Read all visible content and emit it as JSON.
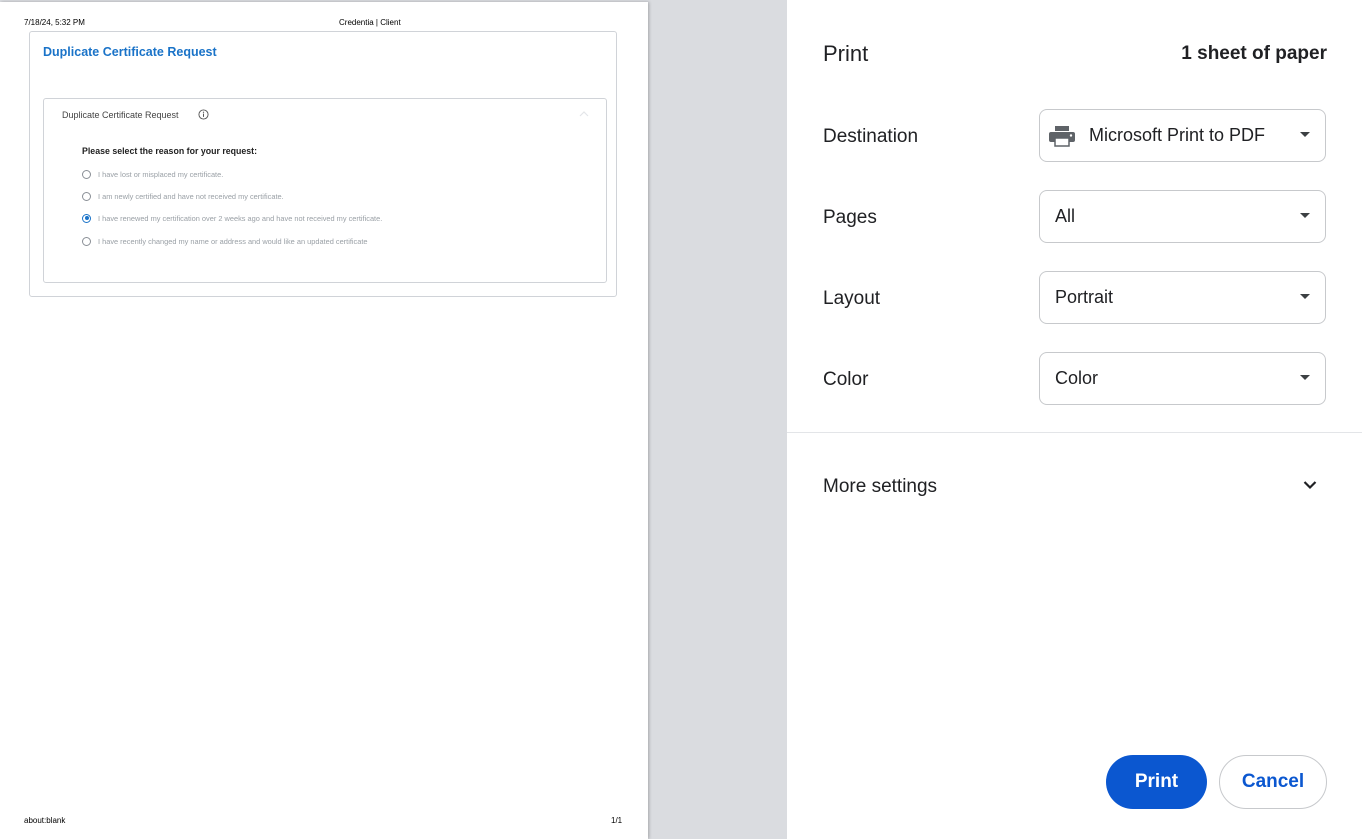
{
  "preview": {
    "header_date": "7/18/24, 5:32 PM",
    "header_title": "Credentia | Client",
    "footer_url": "about:blank",
    "footer_pages": "1/1",
    "card_title": "Duplicate Certificate Request",
    "accordion_title": "Duplicate Certificate Request",
    "question": "Please select the reason for your request:",
    "options": [
      {
        "label": "I have lost or misplaced my certificate.",
        "checked": false
      },
      {
        "label": "I am newly certified and have not received my certificate.",
        "checked": false
      },
      {
        "label": "I have renewed my certification over 2 weeks ago and have not received my certificate.",
        "checked": true
      },
      {
        "label": "I have recently changed my name or address and would like an updated certificate",
        "checked": false
      }
    ]
  },
  "settings": {
    "title": "Print",
    "sheet_count": "1 sheet of paper",
    "destination": {
      "label": "Destination",
      "value": "Microsoft Print to PDF"
    },
    "pages": {
      "label": "Pages",
      "value": "All"
    },
    "layout": {
      "label": "Layout",
      "value": "Portrait"
    },
    "color": {
      "label": "Color",
      "value": "Color"
    },
    "more_settings": "More settings",
    "print_label": "Print",
    "cancel_label": "Cancel"
  },
  "colors": {
    "accent": "#0b57d0",
    "link_blue": "#1a73c8",
    "preview_background": "#dadce0"
  },
  "icons": [
    "info-icon",
    "collapse-icon",
    "printer-icon",
    "dropdown-arrow-icon",
    "chevron-down-icon"
  ]
}
